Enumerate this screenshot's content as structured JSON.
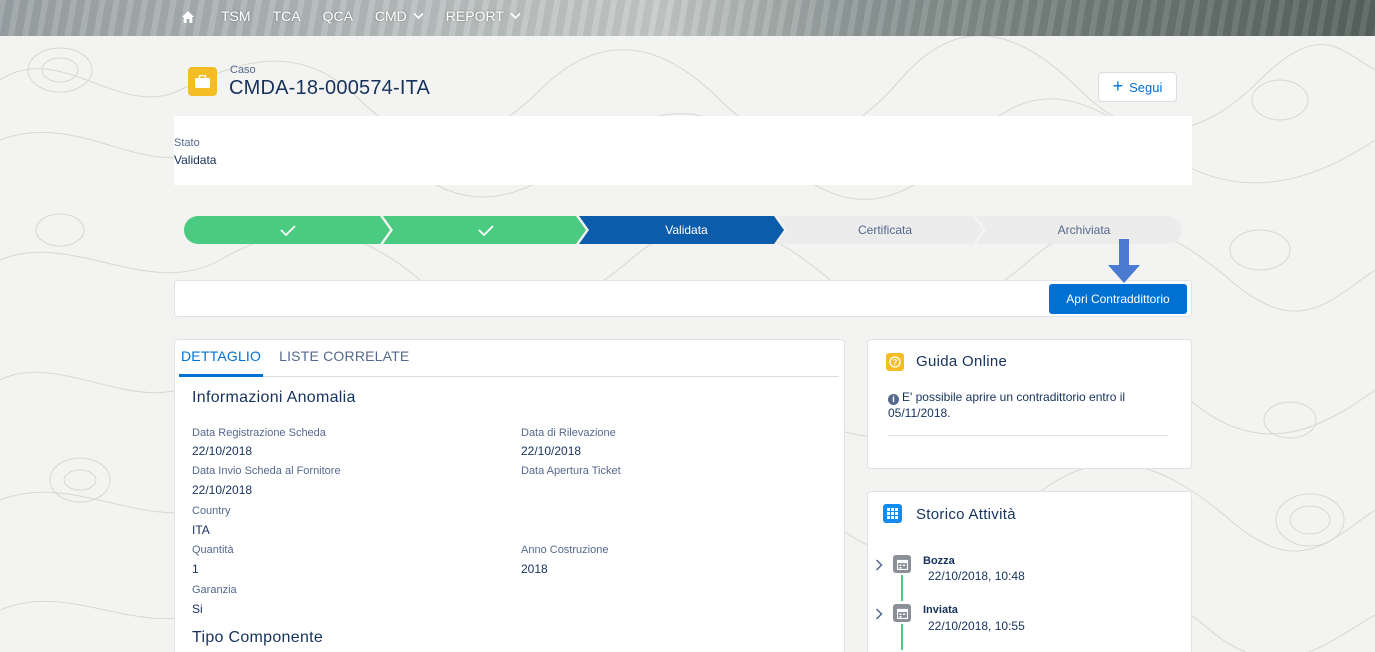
{
  "nav": {
    "items": [
      {
        "label": "TSM",
        "has_dropdown": false
      },
      {
        "label": "TCA",
        "has_dropdown": false
      },
      {
        "label": "QCA",
        "has_dropdown": false
      },
      {
        "label": "CMD",
        "has_dropdown": true
      },
      {
        "label": "REPORT",
        "has_dropdown": true
      }
    ],
    "home_icon": "home-icon"
  },
  "record": {
    "object_label": "Caso",
    "title": "CMDA-18-000574-ITA",
    "icon": "briefcase-icon",
    "follow_label": "Segui"
  },
  "status_card": {
    "label": "Stato",
    "value": "Validata"
  },
  "path": {
    "steps": [
      {
        "label": "",
        "state": "complete",
        "icon": "check-icon"
      },
      {
        "label": "",
        "state": "complete",
        "icon": "check-icon"
      },
      {
        "label": "Validata",
        "state": "current"
      },
      {
        "label": "Certificata",
        "state": "incomplete"
      },
      {
        "label": "Archiviata",
        "state": "incomplete"
      }
    ]
  },
  "actions": {
    "apri_label": "Apri Contraddittorio"
  },
  "tabs": [
    {
      "label": "DETTAGLIO",
      "active": true
    },
    {
      "label": "LISTE CORRELATE",
      "active": false
    }
  ],
  "detail": {
    "section1_title": "Informazioni Anomalia",
    "fields": [
      {
        "label": "Data Registrazione Scheda",
        "value": "22/10/2018"
      },
      {
        "label": "Data di Rilevazione",
        "value": "22/10/2018"
      },
      {
        "label": "Data Invio Scheda al Fornitore",
        "value": "22/10/2018"
      },
      {
        "label": "Data Apertura Ticket",
        "value": ""
      },
      {
        "label": "Country",
        "value": "ITA"
      },
      {
        "label": "Quantità",
        "value": "1"
      },
      {
        "label": "Anno Costruzione",
        "value": "2018"
      },
      {
        "label": "Garanzia",
        "value": "Si"
      }
    ],
    "section2_title": "Tipo Componente"
  },
  "guida": {
    "title": "Guida Online",
    "text": "E' possibile aprire un contradittorio entro il 05/11/2018."
  },
  "storico": {
    "title": "Storico Attività",
    "items": [
      {
        "title": "Bozza",
        "date": "22/10/2018, 10:48"
      },
      {
        "title": "Inviata",
        "date": "22/10/2018, 10:55"
      }
    ]
  },
  "colors": {
    "brand_blue": "#0070d2",
    "path_complete": "#4bca81",
    "path_current": "#0b5cab",
    "path_incomplete": "#ececec",
    "record_icon": "#f4bc25",
    "guida_icon": "#f4bc25",
    "storico_icon": "#1589ee"
  }
}
